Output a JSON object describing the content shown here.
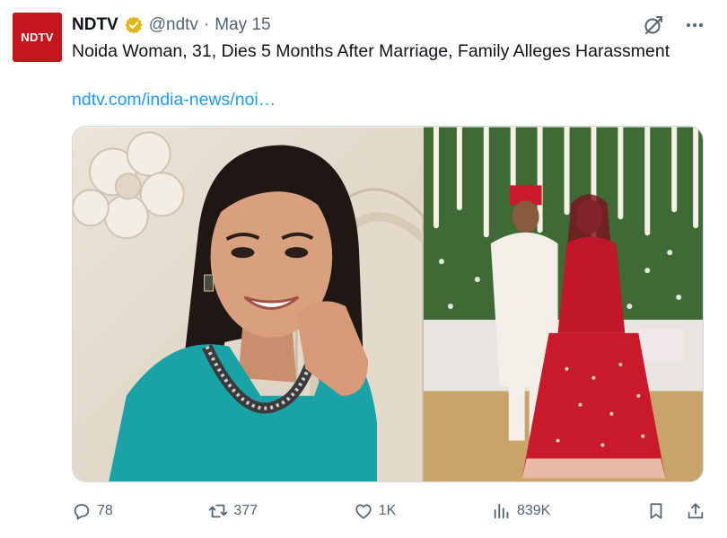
{
  "account": {
    "avatar_text": "NDTV",
    "name": "NDTV",
    "handle": "@ndtv",
    "separator": "·",
    "date": "May 15"
  },
  "tweet": {
    "text": "Noida Woman, 31, Dies 5 Months After Marriage, Family Alleges Harassment",
    "link": "ndtv.com/india-news/noi…"
  },
  "actions": {
    "replies": "78",
    "retweets": "377",
    "likes": "1K",
    "views": "839K"
  },
  "icons": {
    "verified": "verified-badge-icon",
    "grok": "grok-icon",
    "more": "more-icon",
    "reply": "reply-icon",
    "retweet": "retweet-icon",
    "like": "heart-icon",
    "views": "views-icon",
    "bookmark": "bookmark-icon",
    "share": "share-icon"
  },
  "colors": {
    "brand_red": "#c4161c",
    "link_blue": "#1d9bf0",
    "verified_gold": "#e2b719",
    "muted": "#536471"
  }
}
